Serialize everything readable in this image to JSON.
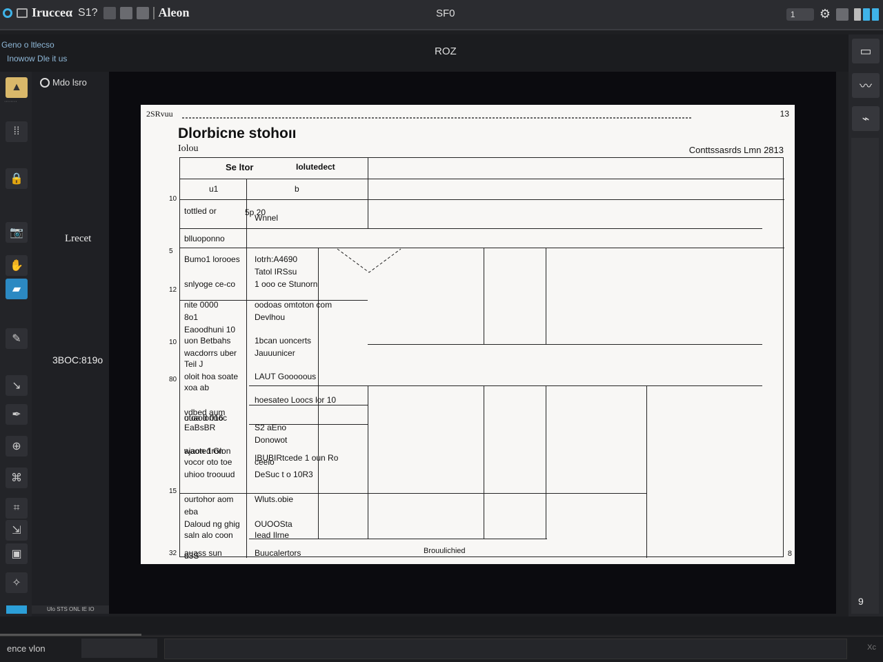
{
  "app": {
    "title": "Ιrucceα",
    "toolbar_value": "S1?",
    "toolbar_name": "Aleon",
    "center_title": "SF0",
    "zoom_pill": "1"
  },
  "subbar": {
    "line1": "Geno o ltlecso",
    "line2": "Inowow Dle it us",
    "center": "ROZ"
  },
  "side_panel": {
    "header": "Mdo lsro",
    "label1": "Lrecet",
    "label2": "3BOC:819o",
    "bottom": "Ulo STS  ONL IE IO"
  },
  "document": {
    "header_small": "2SRvuu",
    "page_number_top": "13",
    "title": "Dlorbicne stohoıı",
    "subtitle": "Iolou",
    "right_header": "Conttssasrds Lmn  2813",
    "footer": "Brouulichied",
    "page_number_bottom": "8",
    "row_labels": [
      "10",
      "5",
      "12",
      "10",
      "80",
      "15",
      "32"
    ],
    "table": {
      "head1": "Se ltor",
      "head2": "Iolutedect",
      "sub1": "u1",
      "sub2": "b",
      "cells": [
        {
          "text": "tottled or",
          "col": "a"
        },
        {
          "text": "5p 20",
          "col": "b"
        },
        {
          "text": "Wnnel",
          "col": "b"
        },
        {
          "text": "blluoponno",
          "col": "a"
        },
        {
          "text": "Iotrh:A4690",
          "col": "b"
        },
        {
          "text": "Bumo1 lorooes",
          "col": "a"
        },
        {
          "text": "Tatol IRSsu",
          "col": "b"
        },
        {
          "text": "snlyoge  ce-co",
          "col": "a"
        },
        {
          "text": "1 ooo ce Stunorn",
          "col": "b"
        },
        {
          "text": "nite 0000",
          "col": "a"
        },
        {
          "text": "oodoas  omtoton com",
          "col": "b"
        },
        {
          "text": "8o1",
          "col": "a"
        },
        {
          "text": "Devlhou",
          "col": "b"
        },
        {
          "text": "Eaoodhuni  10",
          "col": "a"
        },
        {
          "text": "1bcan uoncerts",
          "col": "b"
        },
        {
          "text": "uon Betbahs",
          "col": "a"
        },
        {
          "text": "wacdorrs uber",
          "col": "a"
        },
        {
          "text": "Jauuunicer",
          "col": "b"
        },
        {
          "text": "Teil  J",
          "col": "a"
        },
        {
          "text": "LAUT Gooooous",
          "col": "b"
        },
        {
          "text": "oloit hoa  soate",
          "col": "a"
        },
        {
          "text": "xoa  ab",
          "col": "a"
        },
        {
          "text": "hoesateo Loocs lor  10",
          "col": "b"
        },
        {
          "text": "vdbed aum",
          "col": "a"
        },
        {
          "text": "utoa  lonnoc",
          "col": "a"
        },
        {
          "text": "ouaod 016",
          "col": "a"
        },
        {
          "text": "S2 aEno",
          "col": "b"
        },
        {
          "text": "EaBsBR",
          "col": "a"
        },
        {
          "text": "Donowot",
          "col": "b"
        },
        {
          "text": "waoted Glon",
          "col": "a"
        },
        {
          "text": "ajaon 1ron",
          "col": "a"
        },
        {
          "text": "IBUBIRtcede 1 oun    Ro",
          "col": "b"
        },
        {
          "text": "vocor oto toe",
          "col": "a"
        },
        {
          "text": "ceeio",
          "col": "b"
        },
        {
          "text": "uhioo troouud",
          "col": "a"
        },
        {
          "text": "DeSuc t o 10R3",
          "col": "b"
        },
        {
          "text": "ourtohor aom",
          "col": "a"
        },
        {
          "text": "Wluts.obie",
          "col": "b"
        },
        {
          "text": "eba",
          "col": "a"
        },
        {
          "text": "OUOOSta",
          "col": "b"
        },
        {
          "text": "Daloud ng ghig",
          "col": "a"
        },
        {
          "text": "saln alo  coon",
          "col": "a"
        },
        {
          "text": "Iead Ilrne",
          "col": "b"
        },
        {
          "text": "auass  sun",
          "col": "a"
        },
        {
          "text": "Buucalertors",
          "col": "b"
        },
        {
          "text": "d3S",
          "col": "a"
        }
      ]
    }
  },
  "right_bar": {
    "bottom": "9"
  },
  "status": {
    "left": "ence vlon",
    "right": "Xc"
  },
  "colors": {
    "accent": "#3fb3e8",
    "chrome": "#2b2c30",
    "canvas": "#0b0b0f",
    "paper": "#f8f7f5"
  }
}
